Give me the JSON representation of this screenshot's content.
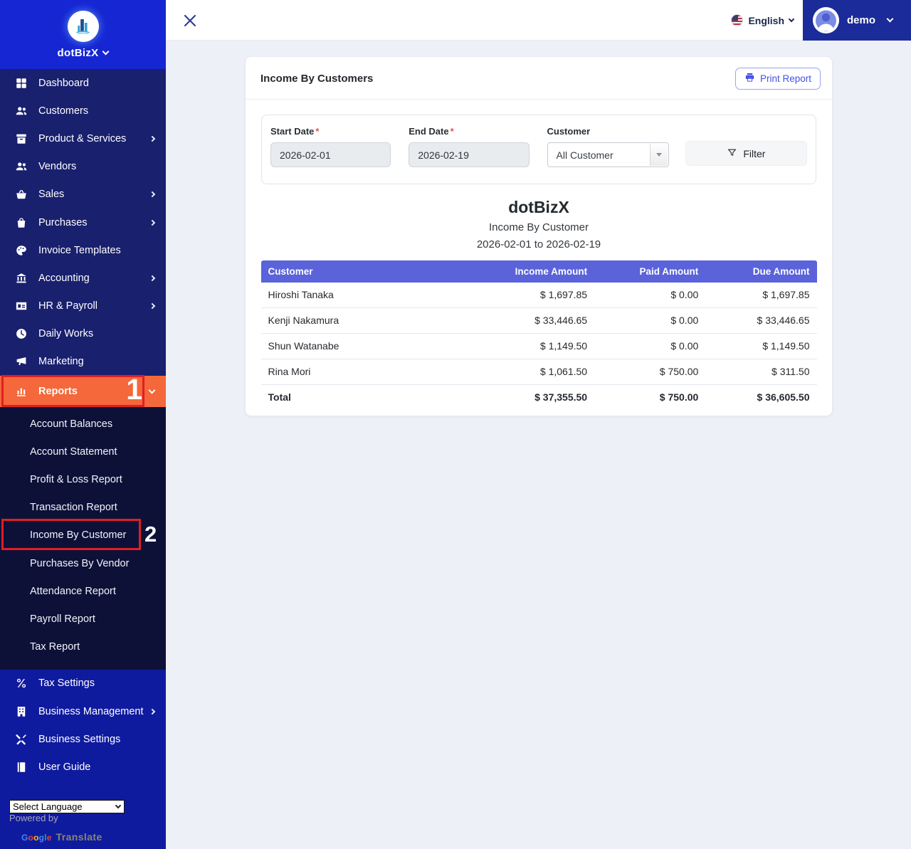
{
  "topbar": {
    "language": {
      "label": "English"
    },
    "user": {
      "name": "demo"
    }
  },
  "sidebar": {
    "brand": "dotBizX",
    "items": [
      {
        "label": "Dashboard",
        "icon": "grid-icon",
        "chevron": "none",
        "active": false
      },
      {
        "label": "Customers",
        "icon": "users-icon",
        "chevron": "none",
        "active": false
      },
      {
        "label": "Product & Services",
        "icon": "box-icon",
        "chevron": "right",
        "active": false
      },
      {
        "label": "Vendors",
        "icon": "users-icon",
        "chevron": "none",
        "active": false
      },
      {
        "label": "Sales",
        "icon": "basket-icon",
        "chevron": "right",
        "active": false
      },
      {
        "label": "Purchases",
        "icon": "shopping-bag-icon",
        "chevron": "right",
        "active": false
      },
      {
        "label": "Invoice Templates",
        "icon": "palette-icon",
        "chevron": "none",
        "active": false
      },
      {
        "label": "Accounting",
        "icon": "bank-icon",
        "chevron": "right",
        "active": false
      },
      {
        "label": "HR & Payroll",
        "icon": "payroll-icon",
        "chevron": "right",
        "active": false
      },
      {
        "label": "Daily Works",
        "icon": "clock-icon",
        "chevron": "none",
        "active": false
      },
      {
        "label": "Marketing",
        "icon": "megaphone-icon",
        "chevron": "none",
        "active": false
      },
      {
        "label": "Reports",
        "icon": "bar-chart-icon",
        "chevron": "down",
        "active": true
      }
    ],
    "submenu": {
      "items": [
        "Account Balances",
        "Account Statement",
        "Profit & Loss Report",
        "Transaction Report",
        "Income By Customer",
        "Purchases By Vendor",
        "Attendance Report",
        "Payroll Report",
        "Tax Report"
      ],
      "active_item": "Income By Customer"
    },
    "bottom_items": [
      {
        "label": "Tax Settings",
        "icon": "percent-icon",
        "chevron": "none"
      },
      {
        "label": "Business Management",
        "icon": "building-icon",
        "chevron": "right"
      },
      {
        "label": "Business Settings",
        "icon": "tools-icon",
        "chevron": "none"
      },
      {
        "label": "User Guide",
        "icon": "book-icon",
        "chevron": "none"
      }
    ],
    "language_select": {
      "value": "Select Language"
    },
    "powered_by": "Powered by",
    "translate_brand": {
      "google": "Google",
      "translate": "Translate"
    }
  },
  "annotations": [
    {
      "number": "1",
      "target": "Reports"
    },
    {
      "number": "2",
      "target": "Income By Customer"
    }
  ],
  "report": {
    "card_title": "Income By Customers",
    "print_button": "Print Report",
    "filters": {
      "start_date": {
        "label": "Start Date",
        "required": "*",
        "value": "2026-02-01"
      },
      "end_date": {
        "label": "End Date",
        "required": "*",
        "value": "2026-02-19"
      },
      "customer": {
        "label": "Customer",
        "value": "All Customer"
      },
      "filter_button": "Filter"
    },
    "heading": {
      "company": "dotBizX",
      "title": "Income By Customer",
      "range": "2026-02-01 to 2026-02-19"
    },
    "table": {
      "columns": [
        "Customer",
        "Income Amount",
        "Paid Amount",
        "Due Amount"
      ],
      "rows": [
        [
          "Hiroshi Tanaka",
          "$ 1,697.85",
          "$ 0.00",
          "$ 1,697.85"
        ],
        [
          "Kenji Nakamura",
          "$ 33,446.65",
          "$ 0.00",
          "$ 33,446.65"
        ],
        [
          "Shun Watanabe",
          "$ 1,149.50",
          "$ 0.00",
          "$ 1,149.50"
        ],
        [
          "Rina Mori",
          "$ 1,061.50",
          "$ 750.00",
          "$ 311.50"
        ]
      ],
      "total": [
        "Total",
        "$ 37,355.50",
        "$ 750.00",
        "$ 36,605.50"
      ]
    }
  },
  "colors": {
    "sidebar_header": "#1626d3",
    "sidebar_menu": "#19206e",
    "sidebar_submenu": "#0d1138",
    "sidebar_bottom": "#0f1b9e",
    "active_orange": "#f4683b",
    "annotation_red": "#e01e25",
    "table_header_purple": "#5a63d9",
    "topbar_user_blue": "#1b2b99",
    "accent_blue": "#4450e6"
  }
}
